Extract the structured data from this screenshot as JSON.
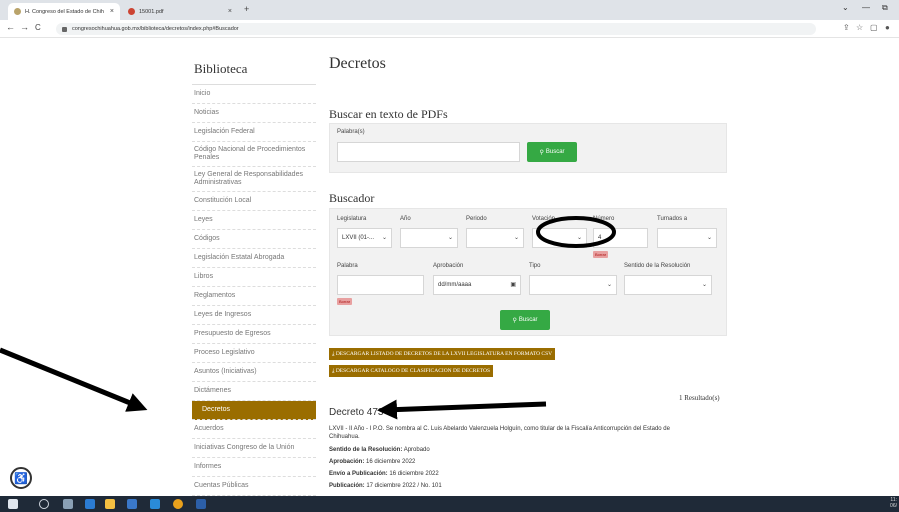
{
  "browser": {
    "tabs": [
      {
        "title": "H. Congreso del Estado de Chih",
        "close": "×"
      },
      {
        "title": "15001.pdf",
        "close": "×"
      }
    ],
    "new_tab": "+",
    "url": "congresochihuahua.gob.mx/biblioteca/decretos/index.php#Buscador",
    "back": "←",
    "forward": "→",
    "reload": "C",
    "win_min": "—",
    "win_chevron": "⌄",
    "win_restore": "⧉"
  },
  "sidebar": {
    "title": "Biblioteca",
    "items": [
      "Inicio",
      "Noticias",
      "Legislación Federal",
      "Código Nacional de Procedimientos Penales",
      "Ley General de Responsabilidades Administrativas",
      "Constitución Local",
      "Leyes",
      "Códigos",
      "Legislación Estatal Abrogada",
      "Libros",
      "Reglamentos",
      "Leyes de Ingresos",
      "Presupuesto de Egresos",
      "Proceso Legislativo",
      "Asuntos (Iniciativas)",
      "Dictámenes",
      "Decretos",
      "Acuerdos",
      "Iniciativas Congreso de la Unión",
      "Informes",
      "Cuentas Públicas"
    ]
  },
  "main": {
    "title": "Decretos",
    "pdf_search": {
      "heading": "Buscar en texto de PDFs",
      "label": "Palabra(s)",
      "button": "Buscar"
    },
    "buscador": {
      "heading": "Buscador",
      "labels": {
        "legislatura": "Legislatura",
        "anio": "Año",
        "periodo": "Periodo",
        "votacion": "Votación",
        "numero": "Número",
        "turnados": "Turnados a",
        "palabra": "Palabra",
        "aprobacion": "Aprobación",
        "tipo": "Tipo",
        "sentido": "Sentido de la Resolución"
      },
      "legislatura_value": "LXVII (01-...",
      "numero_value": "4",
      "date_placeholder": "dd/mm/aaaa",
      "clear": "Borrar",
      "button": "Buscar"
    },
    "downloads": [
      "DESCARGAR LISTADO DE DECRETOS DE LA LXVII LEGISLATURA EN FORMATO CSV",
      "DESCARGAR CATALOGO DE CLASIFICACION DE DECRETOS"
    ],
    "results_count": "1 Resultado(s)",
    "decree": {
      "title": "Decreto 473",
      "summary_line1": "LXVII - II Año - I P.O. Se nombra al C. Luis Abelardo Valenzuela Holguín, como titular de la Fiscalía Anticorrupción del Estado de",
      "summary_line2": "Chihuahua.",
      "sentido_label": "Sentido de la Resolución:",
      "sentido_value": "Aprobado",
      "aprobacion_label": "Aprobación:",
      "aprobacion_value": "16 diciembre 2022",
      "envio_label": "Envío a Publicación:",
      "envio_value": "16 diciembre 2022",
      "publicacion_label": "Publicación:",
      "publicacion_value": "17 diciembre 2022 / No. 101"
    }
  },
  "taskbar": {
    "time": "11:",
    "date": "06/"
  },
  "colors": {
    "gold": "#9a6d00",
    "green": "#35a944",
    "taskbar": "#1f2a38"
  }
}
